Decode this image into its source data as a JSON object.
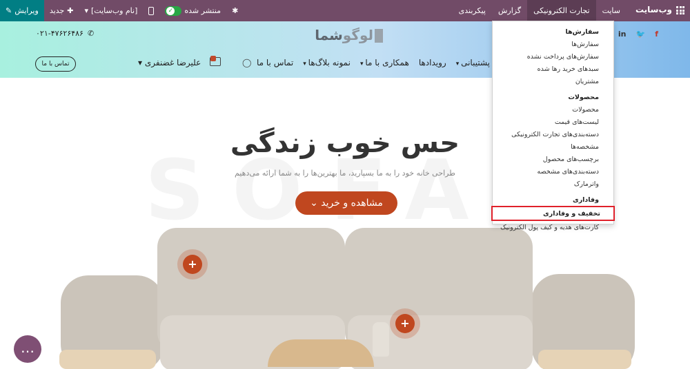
{
  "topbar": {
    "brand": "وب‌سایت",
    "menu": [
      "سایت",
      "تجارت الکترونیکی",
      "گزارش",
      "پیکربندی"
    ],
    "active_menu": "تجارت الکترونیکی",
    "edit_label": "ویرایش",
    "new_label": "جدید",
    "website_name": "[نام وب‌سایت]",
    "published_label": "منتشر شده"
  },
  "header": {
    "logo_text_a": "لوگو",
    "logo_text_b": "شما",
    "phone": "۰۲۱-۴۷۶۲۶۴۸۶",
    "social": [
      "f",
      "🐦",
      "in"
    ],
    "contact_button": "تماس با ما",
    "nav": [
      "پشتیبانی",
      "رویدادها",
      "همکاری با ما",
      "نمونه بلاگ‌ها",
      "تماس با ما"
    ],
    "user": "علیرضا غضنفری"
  },
  "hero": {
    "watermark": "SOFA",
    "title": "حس خوب زندگی",
    "subtitle": "طراحی خانه خود را به ما بسپارید، ما بهترین‌ها را به شما ارائه می‌دهیم",
    "button": "مشاهده و خرید",
    "plus": "+"
  },
  "dropdown": {
    "groups": [
      {
        "heading": "سفارش‌ها",
        "items": [
          "سفارش‌ها",
          "سفارش‌های پرداخت نشده",
          "سبدهای خرید رها شده",
          "مشتریان"
        ]
      },
      {
        "heading": "محصولات",
        "items": [
          "محصولات",
          "لیست‌های قیمت",
          "دسته‌بندی‌های تجارت الکترونیکی",
          "مشخصه‌ها",
          "برچسب‌های محصول",
          "دسته‌بندی‌های مشخصه",
          "واترمارک"
        ]
      },
      {
        "heading": "وفاداری",
        "items": [
          "تخفیف و وفاداری",
          "کارت‌های هدیه و کیف پول الکترونیک"
        ]
      }
    ],
    "highlighted": "تخفیف و وفاداری"
  },
  "colors": {
    "topbar": "#714b67",
    "edit": "#017e84",
    "accent": "#c0471f",
    "highlight_border": "#e0202a"
  }
}
